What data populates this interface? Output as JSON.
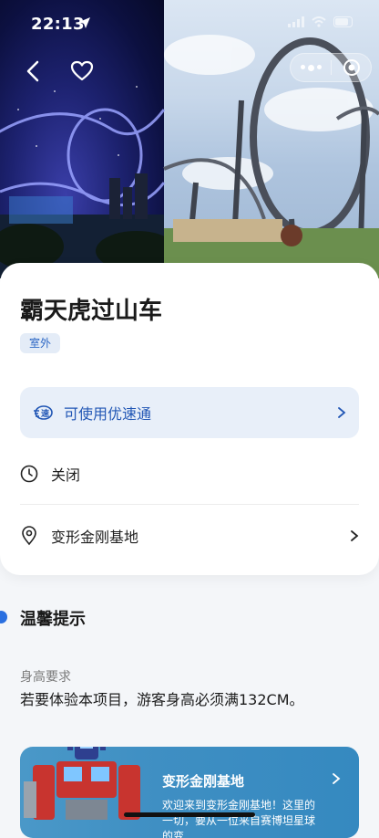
{
  "status_bar": {
    "time": "22:13"
  },
  "attraction": {
    "title": "霸天虎过山车",
    "tag": "室外"
  },
  "express": {
    "icon": "express-pass-icon",
    "label": "可使用优速通"
  },
  "status": {
    "icon": "clock-icon",
    "label": "关闭"
  },
  "location": {
    "icon": "location-pin-icon",
    "label": "变形金刚基地"
  },
  "tips": {
    "title": "温馨提示",
    "requirement_label": "身高要求",
    "requirement_text": "若要体验本项目，游客身高必须满132CM。"
  },
  "banner": {
    "title": "变形金刚基地",
    "text": "欢迎来到变形金刚基地！这里的一切，要从一位来自赛博坦星球的变"
  },
  "colors": {
    "accent": "#2257b5",
    "tag_bg": "#e4ecf7",
    "express_bg": "#e8eff9",
    "tips_dot": "#2a6fe0"
  }
}
